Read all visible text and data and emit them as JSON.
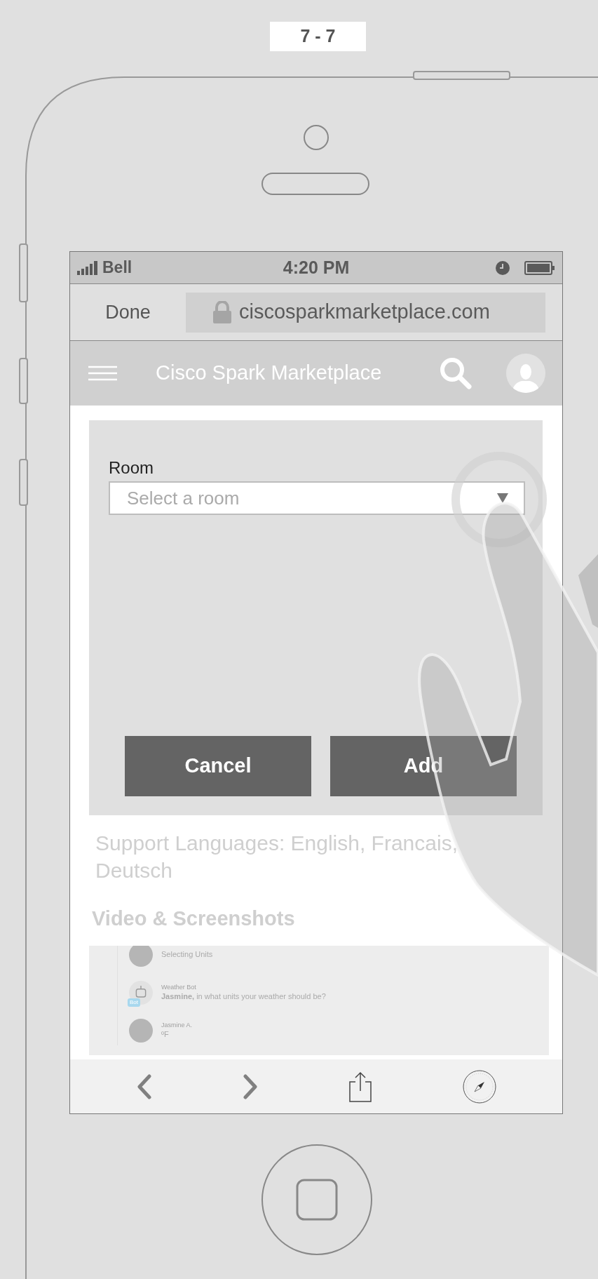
{
  "page_label": "7 - 7",
  "status_bar": {
    "carrier": "Bell",
    "time": "4:20 PM"
  },
  "browser_bar": {
    "done": "Done",
    "url": "ciscosparkmarketplace.com"
  },
  "app_header": {
    "title": "Cisco Spark Marketplace"
  },
  "dialog": {
    "field_label": "Room",
    "select": {
      "placeholder": "Select a room"
    },
    "buttons": [
      "Cancel",
      "Add"
    ]
  },
  "support_languages": "Support Languages: English, Francais, Deutsch",
  "section_heading": "Video & Screenshots",
  "screenshot_preview": {
    "messages": [
      {
        "kind": "user",
        "text": "Selecting Units"
      },
      {
        "kind": "bot",
        "sender": "Weather Bot",
        "badge": "Bot",
        "text": "**Jasmine,** in what units your weather should be?"
      },
      {
        "kind": "user",
        "sender": "Jasmine A.",
        "text": "ºF"
      }
    ]
  }
}
